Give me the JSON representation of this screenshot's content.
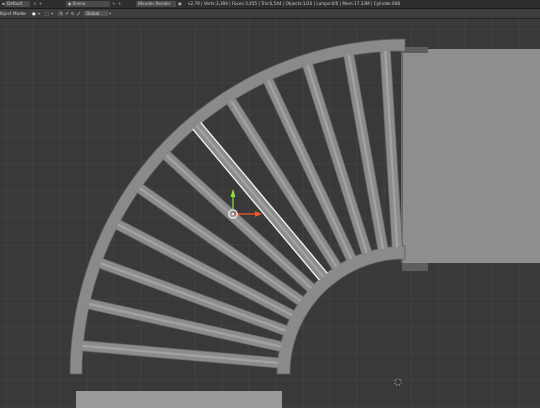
{
  "infobar": {
    "layout_label": "Default",
    "scene_label": "Scene",
    "engine_label": "Blender Render",
    "stats": "v2.79 | Verts:3,394 | Faces:3,455 | Tris:6,544 | Objects:1/20 | Lamps:0/0 | Mem:17.33M | Cylinder.008",
    "icons": {
      "editor": "info-editor-icon",
      "layout": "screen-layout-icon",
      "scene": "scene-icon",
      "close": "close-icon",
      "add": "add-icon",
      "engine": "engine-dropdown-icon",
      "logo": "blender-logo-icon"
    }
  },
  "view_header": {
    "mode_label": "Object Mode",
    "pivot_icon": "pivot-icon",
    "transform_orientation": "Global",
    "icons": [
      "mode-dropdown-icon",
      "shading-sphere-icon",
      "pivot-icon",
      "manipulator-icon",
      "orientation-icon"
    ]
  },
  "viewport": {
    "selected_object": "Cylinder.008",
    "colors": {
      "background": "#393939",
      "grid": "#454545",
      "grid_major": "#4e4e4e",
      "object_fill": "#8c8c8c",
      "object_dark": "#6a6a6a",
      "selection_outline": "#ffffff",
      "widget_y": "#8fe33a",
      "widget_x": "#f05a28"
    }
  }
}
